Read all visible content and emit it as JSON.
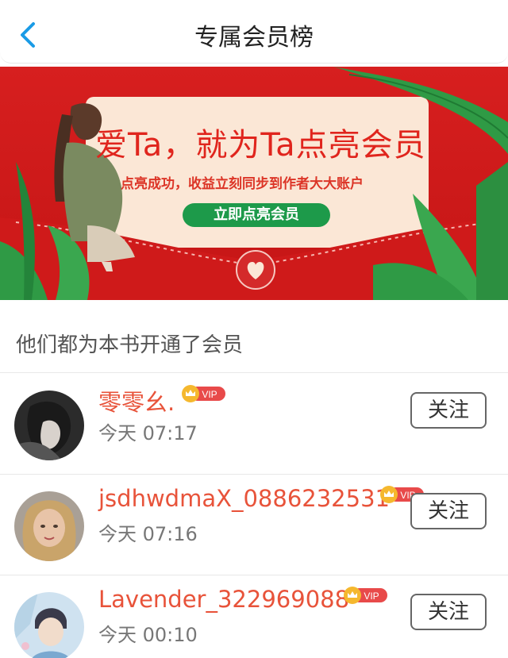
{
  "header": {
    "title": "专属会员榜",
    "back_icon": "chevron-left-icon"
  },
  "banner": {
    "headline": "爱Ta，就为Ta点亮会员",
    "subtitle": "点亮成功，收益立刻同步到作者大大账户",
    "cta_label": "立即点亮会员",
    "colors": {
      "background": "#d71f1f",
      "card": "#fbe7d6",
      "cta": "#1d9a4a",
      "leaf": "#2f9a45"
    }
  },
  "section": {
    "title": "他们都为本书开通了会员"
  },
  "members": [
    {
      "name": "零零幺.",
      "badge": "VIP",
      "time": "今天 07:17",
      "follow_label": "关注"
    },
    {
      "name": "jsdhwdmaX_0886232531",
      "badge": "VIP",
      "time": "今天 07:16",
      "follow_label": "关注"
    },
    {
      "name": "Lavender_322969088",
      "badge": "VIP",
      "time": "今天 00:10",
      "follow_label": "关注"
    }
  ],
  "colors": {
    "name": "#e8533a",
    "vip_badge": "#e84a4a",
    "crown": "#f5b82e"
  }
}
